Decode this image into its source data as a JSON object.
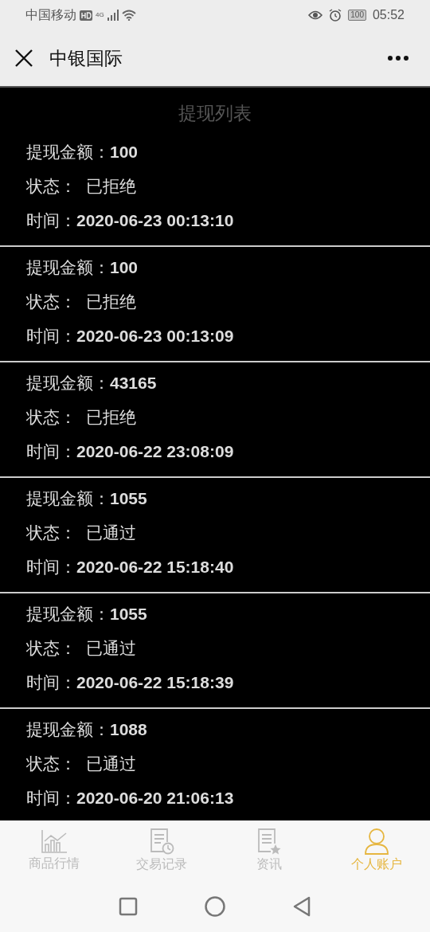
{
  "status_bar": {
    "carrier": "中国移动",
    "network": "4G",
    "battery": "100",
    "time": "05:52"
  },
  "header": {
    "title": "中银国际"
  },
  "list": {
    "title": "提现列表",
    "records": [
      {
        "amount_label": "提现金额：",
        "amount": "100",
        "status_label": "状态：",
        "status": "已拒绝",
        "time_label": "时间：",
        "time": "2020-06-23 00:13:10"
      },
      {
        "amount_label": "提现金额：",
        "amount": "100",
        "status_label": "状态：",
        "status": "已拒绝",
        "time_label": "时间：",
        "time": "2020-06-23 00:13:09"
      },
      {
        "amount_label": "提现金额：",
        "amount": "43165",
        "status_label": "状态：",
        "status": "已拒绝",
        "time_label": "时间：",
        "time": "2020-06-22 23:08:09"
      },
      {
        "amount_label": "提现金额：",
        "amount": "1055",
        "status_label": "状态：",
        "status": "已通过",
        "time_label": "时间：",
        "time": "2020-06-22 15:18:40"
      },
      {
        "amount_label": "提现金额：",
        "amount": "1055",
        "status_label": "状态：",
        "status": "已通过",
        "time_label": "时间：",
        "time": "2020-06-22 15:18:39"
      },
      {
        "amount_label": "提现金额：",
        "amount": "1088",
        "status_label": "状态：",
        "status": "已通过",
        "time_label": "时间：",
        "time": "2020-06-20 21:06:13"
      }
    ]
  },
  "tabs": [
    {
      "label": "商品行情",
      "kind": "chart",
      "selected": false
    },
    {
      "label": "交易记录",
      "kind": "record",
      "selected": false
    },
    {
      "label": "资讯",
      "kind": "news",
      "selected": false
    },
    {
      "label": "个人账户",
      "kind": "person",
      "selected": true
    }
  ]
}
